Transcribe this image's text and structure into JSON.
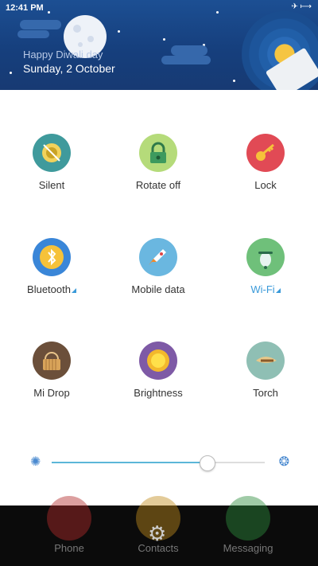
{
  "status_bar": {
    "time": "12:41 PM"
  },
  "banner": {
    "greeting": "Happy Diwali day",
    "date": "Sunday, 2 October"
  },
  "toggles": [
    {
      "label": "Silent",
      "color": "#3f9a9c",
      "icon": "silent-icon"
    },
    {
      "label": "Rotate off",
      "color": "#b5db7a",
      "icon": "lock-rotation-icon"
    },
    {
      "label": "Lock",
      "color": "#e14a55",
      "icon": "key-icon"
    },
    {
      "label": "Bluetooth",
      "color": "#3a86d8",
      "icon": "bluetooth-icon",
      "active": true
    },
    {
      "label": "Mobile data",
      "color": "#6ab7e0",
      "icon": "rocket-icon"
    },
    {
      "label": "Wi-Fi",
      "color": "#6fc07a",
      "icon": "wifi-scooter-icon",
      "active": true
    },
    {
      "label": "Mi Drop",
      "color": "#6b4f3a",
      "icon": "basket-icon"
    },
    {
      "label": "Brightness",
      "color": "#7e5aa6",
      "icon": "sun-icon"
    },
    {
      "label": "Torch",
      "color": "#8fbfb4",
      "icon": "torch-icon"
    }
  ],
  "brightness": {
    "level": 0.73
  },
  "dock": [
    {
      "label": "Phone",
      "color": "#b22a2a"
    },
    {
      "label": "Contacts",
      "color": "#c28b1d"
    },
    {
      "label": "Messaging",
      "color": "#2d8b3c"
    }
  ]
}
